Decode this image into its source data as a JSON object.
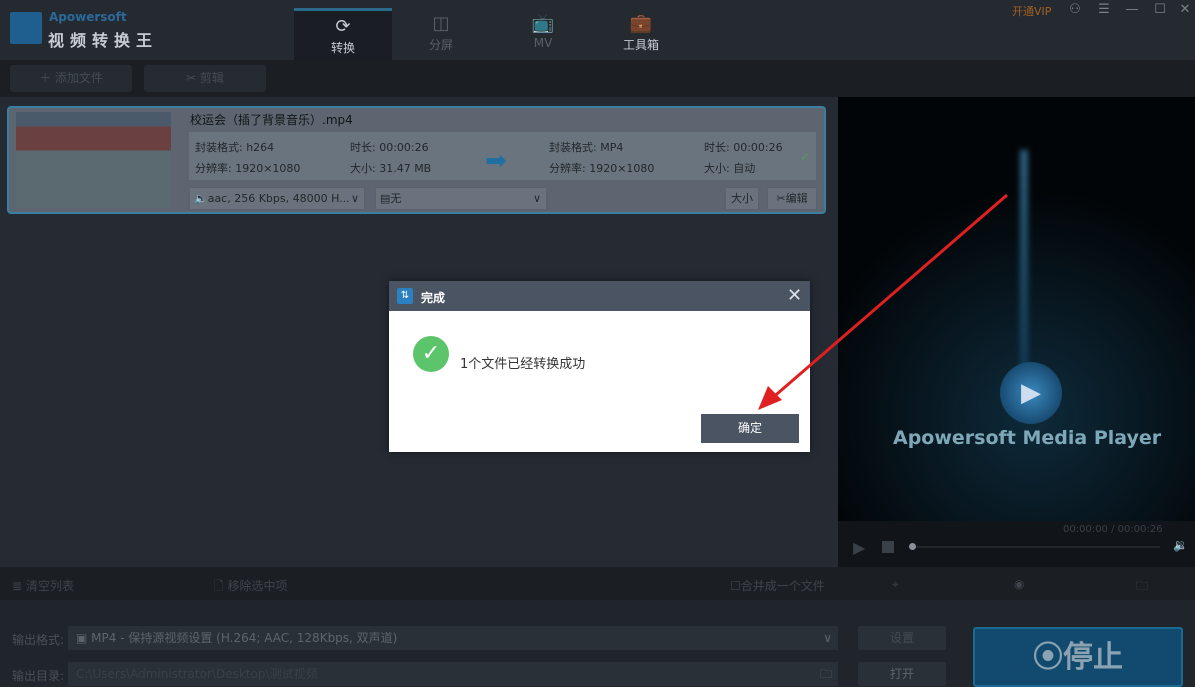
{
  "app": {
    "brand": "Apowersoft",
    "name": "视频转换王",
    "vip": "开通VIP"
  },
  "tabs": [
    {
      "label": "转换"
    },
    {
      "label": "分屏"
    },
    {
      "label": "MV"
    },
    {
      "label": "工具箱"
    }
  ],
  "toolbar": {
    "add_file": "添加文件",
    "cut": "剪辑"
  },
  "file": {
    "name": "校运会（插了背景音乐）.mp4",
    "src_format": "封装格式: h264",
    "src_duration": "时长: 00:00:26",
    "src_resolution": "分辨率: 1920×1080",
    "src_size": "大小: 31.47 MB",
    "dst_format": "封装格式: MP4",
    "dst_duration": "时长: 00:00:26",
    "dst_resolution": "分辨率: 1920×1080",
    "dst_size": "大小: 自动",
    "audio": "aac, 256 Kbps, 48000 H...",
    "subtitle": "无",
    "size_btn": "大小",
    "edit_btn": "编辑"
  },
  "player": {
    "title": "Apowersoft Media Player",
    "time": "00:00:00 / 00:00:26",
    "progress": 0
  },
  "bottombar": {
    "clear": "清空列表",
    "remove": "移除选中项",
    "merge": "合并成一个文件"
  },
  "output": {
    "format_label": "输出格式:",
    "format_value": "MP4 - 保持源视频设置 (H.264; AAC, 128Kbps, 双声道)",
    "settings": "设置",
    "dir_label": "输出目录:",
    "dir_value": "C:\\Users\\Administrator\\Desktop\\测试视频",
    "open": "打开",
    "stop": "停止"
  },
  "dialog": {
    "title": "完成",
    "message": "1个文件已经转换成功",
    "ok": "确定"
  },
  "colors": {
    "accent": "#1f6fa0",
    "success": "#5cc46a",
    "annotation": "#e02020"
  }
}
